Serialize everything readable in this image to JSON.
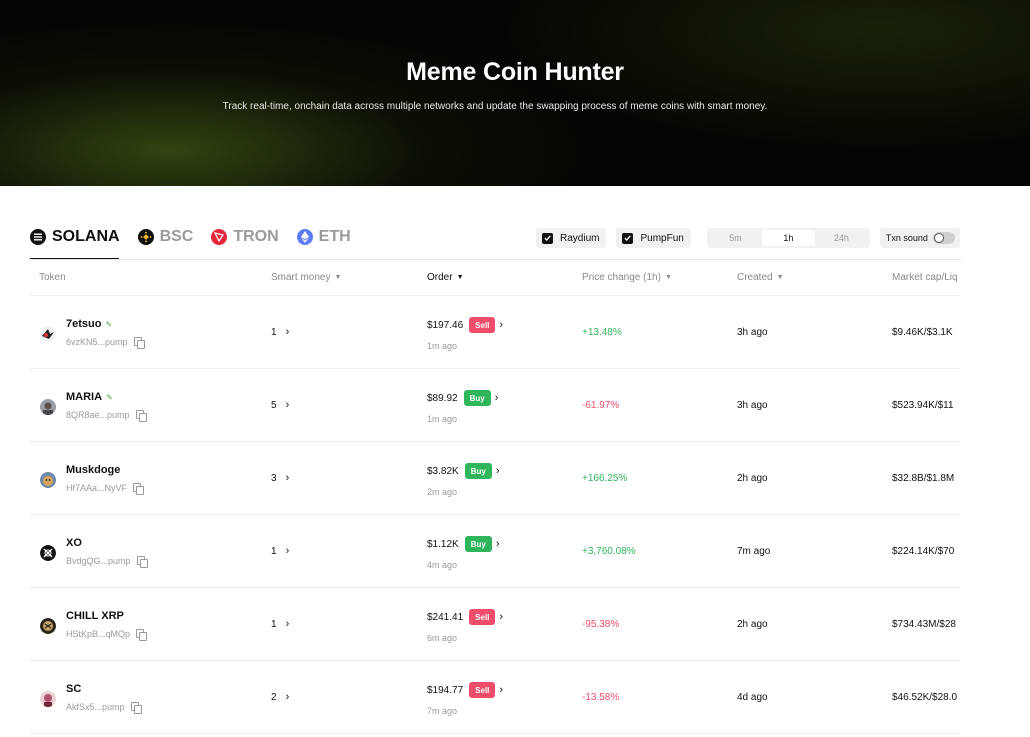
{
  "hero": {
    "title": "Meme Coin Hunter",
    "subtitle": "Track real-time, onchain data across multiple networks and update the swapping process of meme coins with smart money."
  },
  "chains": [
    {
      "label": "SOLANA",
      "icon": "solana-icon",
      "active": true
    },
    {
      "label": "BSC",
      "icon": "bsc-icon",
      "active": false
    },
    {
      "label": "TRON",
      "icon": "tron-icon",
      "active": false
    },
    {
      "label": "ETH",
      "icon": "eth-icon",
      "active": false
    }
  ],
  "filters": {
    "raydium": "Raydium",
    "pumpfun": "PumpFun",
    "timeframes": [
      "5m",
      "1h",
      "24h"
    ],
    "active_timeframe": "1h",
    "txn_sound": "Txn sound"
  },
  "columns": {
    "token": "Token",
    "smart_money": "Smart money",
    "order": "Order",
    "price_change": "Price change (1h)",
    "created": "Created",
    "market_cap": "Market cap/Liq"
  },
  "rows": [
    {
      "name": "7etsuo",
      "addr": "6vzKN5...pump",
      "smart": "1",
      "price": "$197.46",
      "side": "Sell",
      "time": "1m ago",
      "change": "+13.48%",
      "created": "3h ago",
      "mcap": "$9.46K/$3.1K"
    },
    {
      "name": "MARIA",
      "addr": "8QR8ae...pump",
      "smart": "5",
      "price": "$89.92",
      "side": "Buy",
      "time": "1m ago",
      "change": "-61.97%",
      "created": "3h ago",
      "mcap": "$523.94K/$11"
    },
    {
      "name": "Muskdoge",
      "addr": "Hf7AAa...NyVF",
      "smart": "3",
      "price": "$3.82K",
      "side": "Buy",
      "time": "2m ago",
      "change": "+166.25%",
      "created": "2h ago",
      "mcap": "$32.8B/$1.8M"
    },
    {
      "name": "XO",
      "addr": "BvdgQG...pump",
      "smart": "1",
      "price": "$1.12K",
      "side": "Buy",
      "time": "4m ago",
      "change": "+3,760.08%",
      "created": "7m ago",
      "mcap": "$224.14K/$70"
    },
    {
      "name": "CHILL XRP",
      "addr": "HStKpB...qMQp",
      "smart": "1",
      "price": "$241.41",
      "side": "Sell",
      "time": "6m ago",
      "change": "-95.38%",
      "created": "2h ago",
      "mcap": "$734.43M/$28"
    },
    {
      "name": "SC",
      "addr": "AkfSx5...pump",
      "smart": "2",
      "price": "$194.77",
      "side": "Sell",
      "time": "7m ago",
      "change": "-13.58%",
      "created": "4d ago",
      "mcap": "$46.52K/$28.0"
    }
  ],
  "colors": {
    "buy": "#2fb55b",
    "sell": "#ef4d6a",
    "accent_dark": "#111111"
  }
}
